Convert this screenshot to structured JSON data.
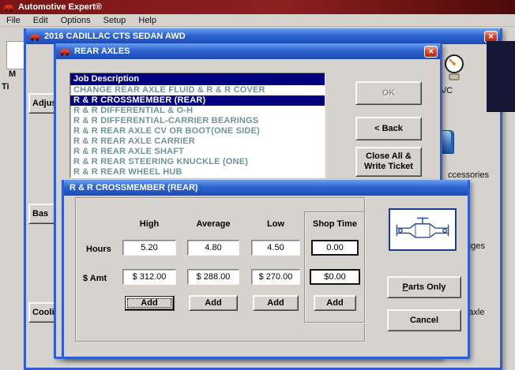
{
  "colors": {
    "titlebar_blue": "#2E5FD0",
    "titlebar_maroon": "#7A1515",
    "selection_navy": "#000080",
    "list_item_text": "#6E9494",
    "close_button_red": "#C23B23",
    "diagram_blue": "#2D4F8F"
  },
  "icons": {
    "close_glyph": "✕"
  },
  "app": {
    "title": "Automotive Expert®",
    "menu": [
      "File",
      "Edit",
      "Options",
      "Setup",
      "Help"
    ]
  },
  "vehicle_window": {
    "title": "2016 CADILLAC CTS SEDAN AWD"
  },
  "background": {
    "partial_m": "M",
    "partial_ti": "Ti",
    "left_buttons": [
      "Adjust",
      "Bas",
      "Cooli"
    ],
    "right_labels": [
      "& A/C",
      "ccessories",
      "auges",
      "ns-axle"
    ]
  },
  "rear_axles_dialog": {
    "title": "REAR AXLES",
    "list_header": "Job Description",
    "items": [
      "CHANGE REAR AXLE FLUID & R & R COVER",
      "R & R CROSSMEMBER (REAR)",
      "R & R DIFFERENTIAL & O-H",
      "R & R DIFFERENTIAL-CARRIER BEARINGS",
      "R & R REAR AXLE CV OR BOOT(ONE SIDE)",
      "R & R REAR AXLE CARRIER",
      "R & R REAR AXLE SHAFT",
      "R & R REAR STEERING KNUCKLE (ONE)",
      "R & R REAR WHEEL HUB"
    ],
    "ok_label": "OK",
    "back_label": "< Back",
    "close_all_label": "Close All & Write Ticket"
  },
  "labor_dialog": {
    "title": "R & R CROSSMEMBER (REAR)",
    "headers": [
      "High",
      "Average",
      "Low",
      "Shop Time"
    ],
    "hours_label": "Hours",
    "amount_label": "$ Amt",
    "hours": [
      "5.20",
      "4.80",
      "4.50",
      "0.00"
    ],
    "amounts": [
      "$ 312.00",
      "$ 288.00",
      "$ 270.00",
      "$0.00"
    ],
    "add_label": "Add",
    "parts_only_label": "Parts Only",
    "cancel_label": "Cancel"
  }
}
